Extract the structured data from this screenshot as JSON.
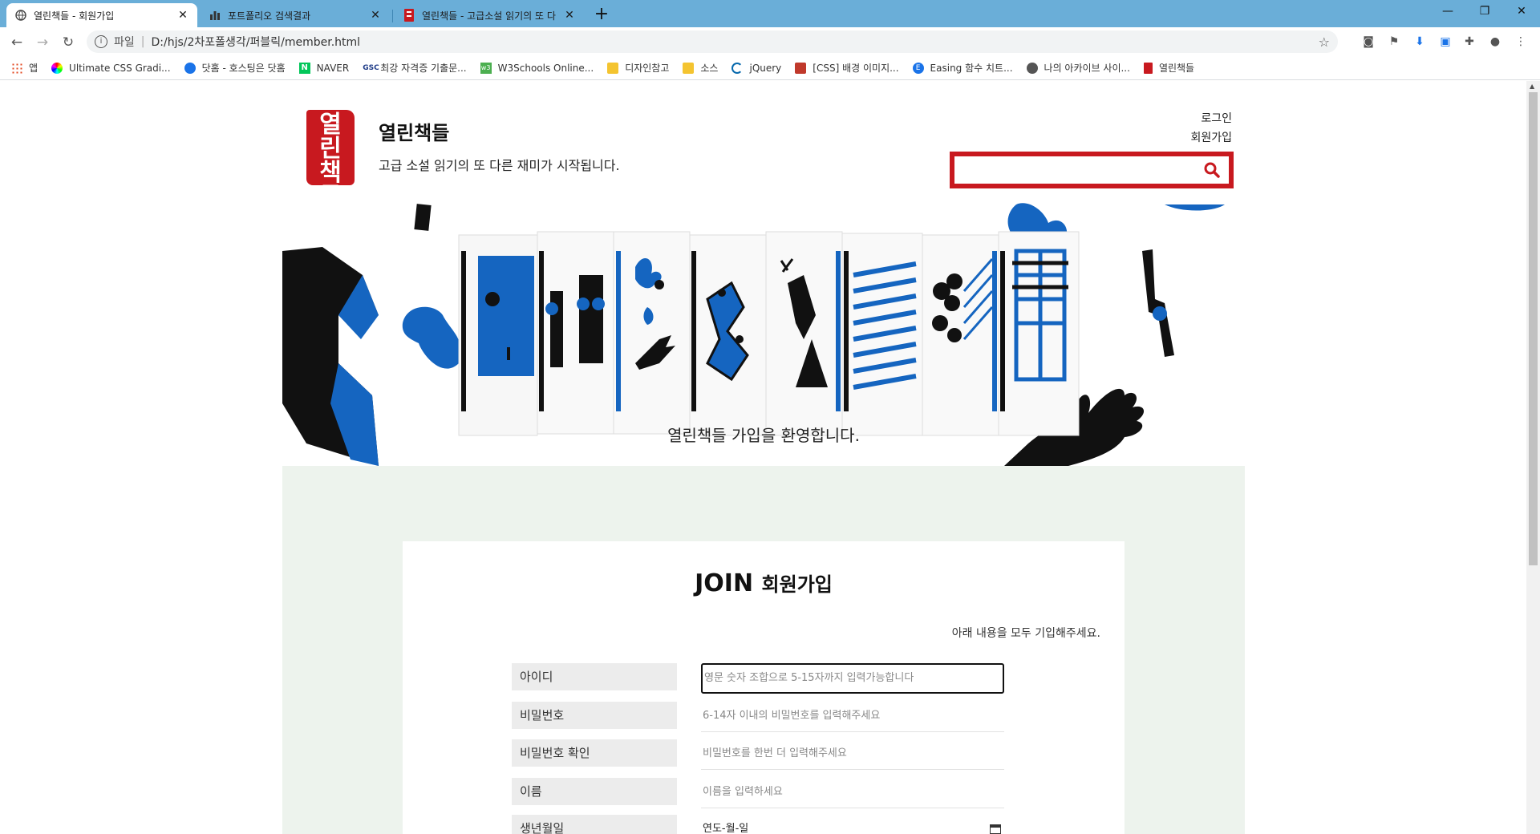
{
  "browser": {
    "tabs": [
      {
        "title": "열린책들 - 회원가입",
        "active": true
      },
      {
        "title": "포트폴리오 검색결과",
        "active": false
      },
      {
        "title": "열린책들 - 고급소설 읽기의 또 다",
        "active": false
      }
    ],
    "url_scheme": "파일",
    "url_path": "D:/hjs/2차포폴생각/퍼블릭/member.html",
    "bookmarks": [
      {
        "label": "앱",
        "color": "#e34c26"
      },
      {
        "label": "Ultimate CSS Gradi...",
        "color": "#8e44ad"
      },
      {
        "label": "닷홈 - 호스팅은 닷홈",
        "color": "#1a73e8"
      },
      {
        "label": "NAVER",
        "color": "#03c75a"
      },
      {
        "label": "최강 자격증 기출문...",
        "color": "#1f3c88"
      },
      {
        "label": "W3Schools Online...",
        "color": "#4caf50"
      },
      {
        "label": "디자인참고",
        "color": "#f4c430"
      },
      {
        "label": "소스",
        "color": "#f4c430"
      },
      {
        "label": "jQuery",
        "color": "#0769ad"
      },
      {
        "label": "[CSS] 배경 이미지...",
        "color": "#c0392b"
      },
      {
        "label": "Easing 함수 치트...",
        "color": "#1a73e8"
      },
      {
        "label": "나의 아카이브 사이...",
        "color": "#555555"
      },
      {
        "label": "열린책들",
        "color": "#c8191f"
      }
    ]
  },
  "header": {
    "logo_text": "열린책들",
    "site_name": "열린책들",
    "tagline": "고급 소설 읽기의 또 다른 재미가 시작됩니다.",
    "login": "로그인",
    "join": "회원가입",
    "search_placeholder": "",
    "accent": "#c8191f"
  },
  "banner": {
    "welcome": "열린책들 가입을 환영합니다."
  },
  "join": {
    "title_en": "JOIN",
    "title_ko": "회원가입",
    "note": "아래 내용을 모두 기입해주세요.",
    "fields": [
      {
        "label": "아이디",
        "placeholder": "영문 숫자 조합으로 5-15자까지 입력가능합니다"
      },
      {
        "label": "비밀번호",
        "placeholder": "6-14자 이내의 비밀번호를 입력해주세요"
      },
      {
        "label": "비밀번호 확인",
        "placeholder": "비밀번호를 한번 더 입력해주세요"
      },
      {
        "label": "이름",
        "placeholder": "이름을 입력하세요"
      },
      {
        "label": "생년월일",
        "placeholder": "연도-월-일"
      }
    ]
  }
}
